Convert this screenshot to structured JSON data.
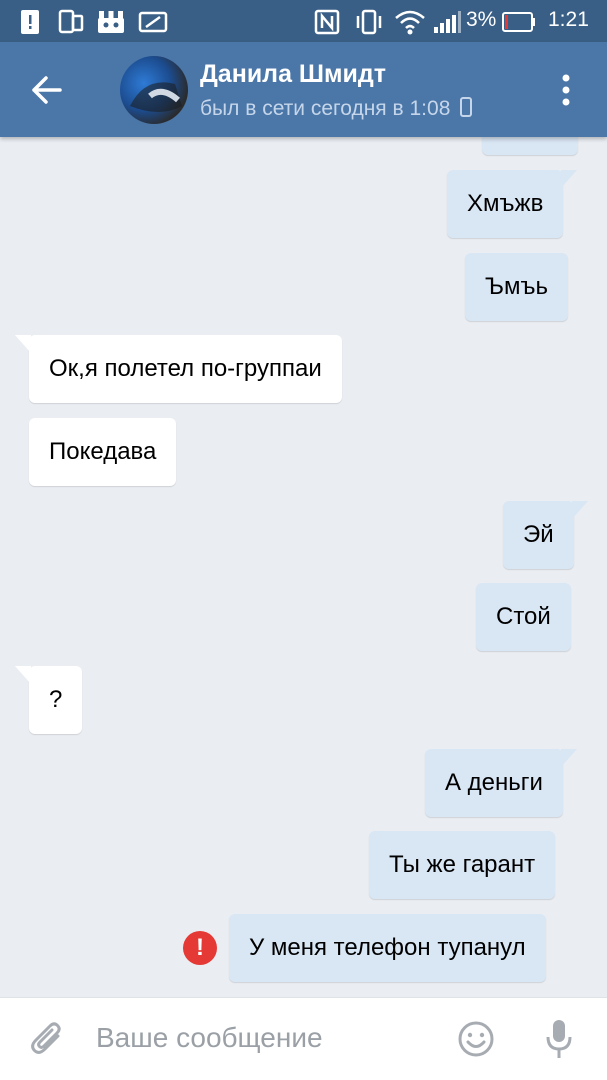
{
  "status_bar": {
    "battery": "3%",
    "time": "1:21"
  },
  "header": {
    "name": "Данила Шмидт",
    "status": "был в сети сегодня в 1:08"
  },
  "messages": [
    {
      "text": "Хмъжв",
      "dir": "out"
    },
    {
      "text": "Ъмъь",
      "dir": "out"
    },
    {
      "text": "Ок,я полетел по-группаи",
      "dir": "in"
    },
    {
      "text": "Покедава",
      "dir": "in"
    },
    {
      "text": "Эй",
      "dir": "out"
    },
    {
      "text": "Стой",
      "dir": "out"
    },
    {
      "text": "?",
      "dir": "in"
    },
    {
      "text": "А деньги",
      "dir": "out"
    },
    {
      "text": "Ты же гарант",
      "dir": "out"
    },
    {
      "text": "У меня телефон тупанул",
      "dir": "out",
      "failed": true
    }
  ],
  "error_icon_symbol": "!",
  "input": {
    "placeholder": "Ваше сообщение"
  },
  "colors": {
    "status_bar": "#3a5f86",
    "header": "#4a76a8",
    "background": "#eaeef3",
    "incoming_bubble": "#ffffff",
    "outgoing_bubble": "#d9e6f4",
    "error": "#e53935"
  },
  "icons": {
    "back": "arrow-left-icon",
    "menu": "more-vertical-icon",
    "attach": "paperclip-icon",
    "emoji": "smiley-icon",
    "mic": "microphone-icon",
    "error": "exclamation-circle-icon"
  }
}
